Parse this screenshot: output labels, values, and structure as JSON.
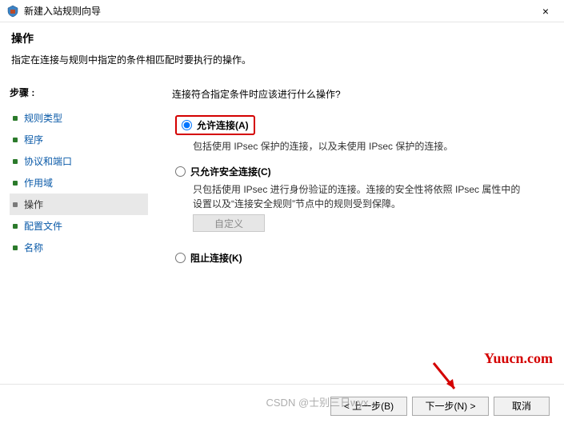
{
  "window": {
    "title": "新建入站规则向导",
    "close_label": "×"
  },
  "header": {
    "heading": "操作",
    "subheading": "指定在连接与规则中指定的条件相匹配时要执行的操作。"
  },
  "sidebar": {
    "steps_label": "步骤 :",
    "items": [
      {
        "label": "规则类型"
      },
      {
        "label": "程序"
      },
      {
        "label": "协议和端口"
      },
      {
        "label": "作用域"
      },
      {
        "label": "操作",
        "current": true
      },
      {
        "label": "配置文件"
      },
      {
        "label": "名称"
      }
    ]
  },
  "main": {
    "question": "连接符合指定条件时应该进行什么操作?",
    "options": {
      "allow": {
        "label": "允许连接(A)",
        "desc": "包括使用 IPsec 保护的连接，以及未使用 IPsec 保护的连接。"
      },
      "secure": {
        "label": "只允许安全连接(C)",
        "desc": "只包括使用 IPsec 进行身份验证的连接。连接的安全性将依照 IPsec 属性中的设置以及“连接安全规则”节点中的规则受到保障。"
      },
      "block": {
        "label": "阻止连接(K)"
      }
    },
    "custom_button": "自定义"
  },
  "footer": {
    "back": "< 上一步(B)",
    "next": "下一步(N) >",
    "cancel": "取消"
  },
  "overlay": {
    "footer_watermark": "CSDN @士别三日wyx",
    "brand": "Yuucn.com"
  }
}
